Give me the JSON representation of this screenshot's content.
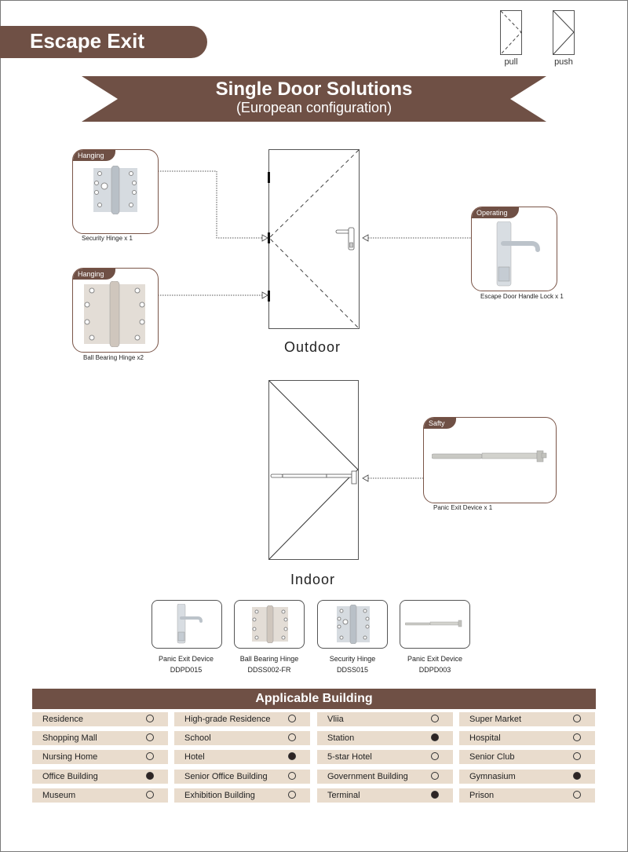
{
  "header": {
    "title": "Escape Exit",
    "legend": [
      {
        "label": "pull",
        "style": "dashed"
      },
      {
        "label": "push",
        "style": "solid"
      }
    ]
  },
  "banner": {
    "title": "Single Door Solutions",
    "subtitle": "(European configuration)"
  },
  "outdoor": {
    "label": "Outdoor",
    "components": [
      {
        "tag": "Hanging",
        "caption": "Security Hinge x 1",
        "icon": "security-hinge-icon"
      },
      {
        "tag": "Hanging",
        "caption": "Ball Bearing Hinge x2",
        "icon": "ball-bearing-hinge-icon"
      },
      {
        "tag": "Operating",
        "caption": "Escape Door Handle Lock  x 1",
        "icon": "door-handle-lock-icon"
      }
    ]
  },
  "indoor": {
    "label": "Indoor",
    "components": [
      {
        "tag": "Safty",
        "caption": "Panic  Exit  Device x 1",
        "icon": "panic-bar-icon"
      }
    ]
  },
  "products": [
    {
      "name": "Panic Exit Device",
      "code": "DDPD015",
      "icon": "door-handle-lock-icon"
    },
    {
      "name": "Ball Bearing Hinge",
      "code": "DDSS002-FR",
      "icon": "ball-bearing-hinge-icon"
    },
    {
      "name": "Security Hinge",
      "code": "DDSS015",
      "icon": "security-hinge-icon"
    },
    {
      "name": "Panic Exit Device",
      "code": "DDPD003",
      "icon": "panic-bar-icon"
    }
  ],
  "applicable_building": {
    "title": "Applicable Building",
    "columns": [
      [
        {
          "label": "Residence",
          "applicable": false
        },
        {
          "label": "Shopping Mall",
          "applicable": false
        },
        {
          "label": "Nursing Home",
          "applicable": false
        },
        {
          "label": "Office Building",
          "applicable": true
        },
        {
          "label": "Museum",
          "applicable": false
        }
      ],
      [
        {
          "label": "High-grade Residence",
          "applicable": false
        },
        {
          "label": "School",
          "applicable": false
        },
        {
          "label": "Hotel",
          "applicable": true
        },
        {
          "label": "Senior Office Building",
          "applicable": false
        },
        {
          "label": "Exhibition Building",
          "applicable": false
        }
      ],
      [
        {
          "label": "Vliia",
          "applicable": false
        },
        {
          "label": "Station",
          "applicable": true
        },
        {
          "label": "5-star Hotel",
          "applicable": false
        },
        {
          "label": "Government Building",
          "applicable": false
        },
        {
          "label": "Terminal",
          "applicable": true
        }
      ],
      [
        {
          "label": "Super Market",
          "applicable": false
        },
        {
          "label": "Hospital",
          "applicable": false
        },
        {
          "label": "Senior Club",
          "applicable": false
        },
        {
          "label": "Gymnasium",
          "applicable": true
        },
        {
          "label": "Prison",
          "applicable": false
        }
      ]
    ]
  },
  "colors": {
    "brand_brown": "#6f5045",
    "cell_beige": "#e9dccd",
    "filled_dot": "#2d2424"
  }
}
